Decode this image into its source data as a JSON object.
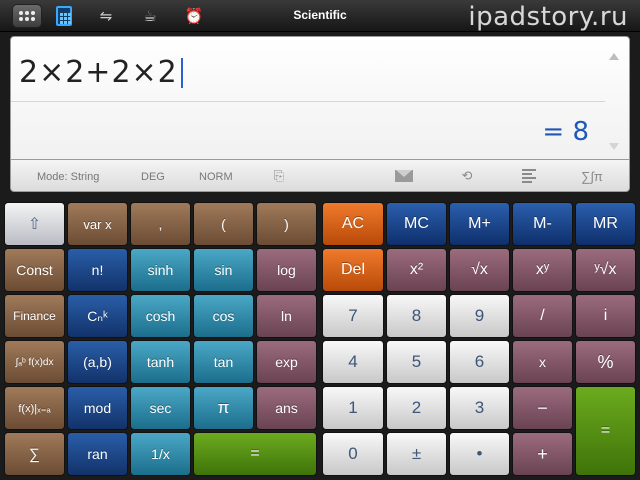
{
  "header": {
    "title": "Scientific",
    "watermark": "ipadstory.ru",
    "icons": [
      "grid-icon",
      "calculator-icon",
      "converter-icon",
      "cup-icon",
      "alarm-clock-icon"
    ]
  },
  "display": {
    "expression": "2×2+2×2",
    "result": "= 8"
  },
  "status": {
    "mode": "Mode: String",
    "angle": "DEG",
    "format": "NORM",
    "icons": [
      "paste-icon",
      "mail-icon",
      "history-icon",
      "list-icon",
      "sum-pi-icon"
    ],
    "sum_glyph": "∑∫π"
  },
  "keys": {
    "shift": "⇧",
    "var_x": "var x",
    "comma": ",",
    "lparen": "(",
    "rparen": ")",
    "const": "Const",
    "factorial": "n!",
    "sinh": "sinh",
    "sin": "sin",
    "log": "log",
    "finance": "Finance",
    "combination": "Cₙᵏ",
    "cosh": "cosh",
    "cos": "cos",
    "ln": "ln",
    "integral": "∫ₐᵇ f(x)dx",
    "pair": "(a,b)",
    "tanh": "tanh",
    "tan": "tan",
    "exp": "exp",
    "fx_at": "f(x)|ₓ₌ₐ",
    "mod": "mod",
    "sec": "sec",
    "pi": "π",
    "ans": "ans",
    "sum": "∑",
    "ran": "ran",
    "reciprocal": "1/x",
    "equals_wide": "=",
    "ac": "AC",
    "mc": "MC",
    "mplus": "M+",
    "mminus": "M-",
    "mr": "MR",
    "del": "Del",
    "square": "x²",
    "sqrt": "√x",
    "power": "xʸ",
    "root": "ʸ√x",
    "seven": "7",
    "eight": "8",
    "nine": "9",
    "divide": "/",
    "imag": "i",
    "four": "4",
    "five": "5",
    "six": "6",
    "multiply": "x",
    "percent": "%",
    "one": "1",
    "two": "2",
    "three": "3",
    "minus": "−",
    "equals_tall": "=",
    "zero": "0",
    "plusminus": "±",
    "dot": "•",
    "plus": "+"
  },
  "colors": {
    "orange": "#e0641a",
    "navy": "#1a468c",
    "grey": "#dcdcdc",
    "mauve": "#7d5565",
    "green": "#569118",
    "brown": "#86624a",
    "blue": "#1d4a8a",
    "teal": "#2f8aa8"
  }
}
